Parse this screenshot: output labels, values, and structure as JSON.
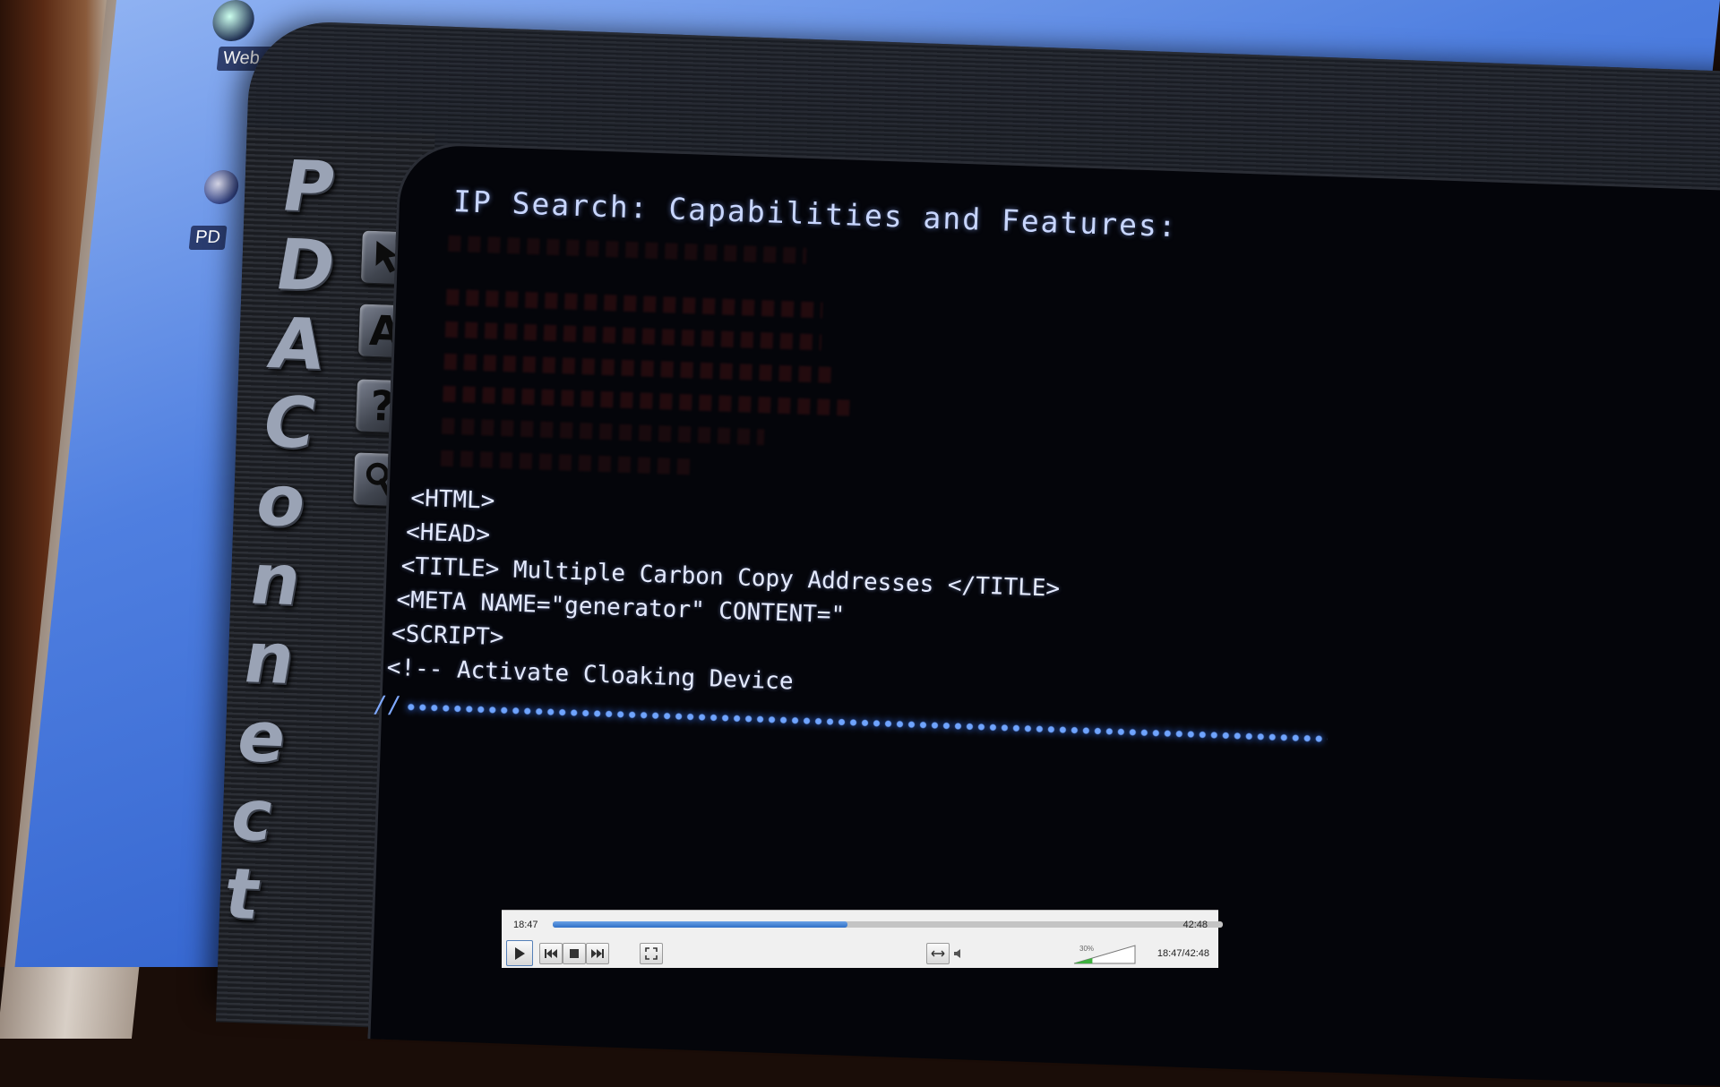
{
  "desktop": {
    "icons": [
      {
        "label": "Web Br"
      },
      {
        "label": "PD"
      }
    ]
  },
  "app": {
    "brand_letters": [
      "P",
      "D",
      "A",
      "C",
      "o",
      "n",
      "n",
      "e",
      "c",
      "t"
    ],
    "tools": [
      {
        "name": "pointer-tool",
        "glyph": ""
      },
      {
        "name": "text-tool",
        "glyph": "A"
      },
      {
        "name": "help-tool",
        "glyph": "?"
      },
      {
        "name": "search-tool",
        "glyph": ""
      }
    ],
    "heading": "IP Search: Capabilities and Features:",
    "code_lines": [
      "<HTML>",
      "<HEAD>",
      "<TITLE> Multiple Carbon Copy Addresses </TITLE>",
      "<META NAME=\"generator\" CONTENT=\"",
      "<SCRIPT>",
      "<!-- Activate Cloaking Device"
    ],
    "dots_prefix": "//"
  },
  "player": {
    "elapsed": "18:47",
    "total": "42:48",
    "progress": 0.44,
    "volume_label": "30%",
    "volume_level": 0.3,
    "time_combo": "18:47/42:48"
  },
  "colors": {
    "accent": "#2f6fc6",
    "code_text": "#e4eaff",
    "dots": "#6fa4ff"
  }
}
